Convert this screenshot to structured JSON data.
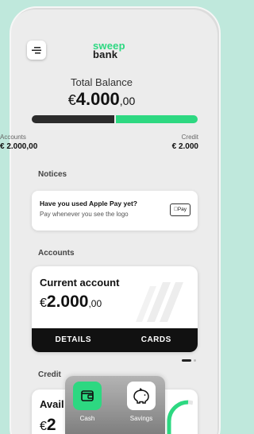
{
  "brand": {
    "line1": "sweep",
    "line2": "bank"
  },
  "balance": {
    "label": "Total Balance",
    "currency": "€",
    "main": "4.000",
    "decimals": ",00"
  },
  "balance_split": {
    "accounts_fraction": 0.5,
    "credit_fraction": 0.5
  },
  "legend": {
    "left_label": "Accounts",
    "left_value": "€ 2.000,00",
    "right_label": "Credit",
    "right_value": "€ 2.000"
  },
  "notices": {
    "title": "Notices",
    "card_title": "Have you used Apple Pay yet?",
    "card_subtitle": "Pay whenever you see the logo",
    "badge": "Pay"
  },
  "accounts": {
    "title": "Accounts",
    "card_name": "Current account",
    "currency": "€",
    "main": "2.000",
    "decimals": ",00",
    "details_label": "DETAILS",
    "cards_label": "CARDS"
  },
  "credit": {
    "title": "Credit",
    "available_label": "Avail",
    "currency": "€",
    "main": "2"
  },
  "dock": {
    "items": [
      {
        "label": "Cash",
        "icon": "wallet-icon"
      },
      {
        "label": "Savings",
        "icon": "piggy-bank-icon"
      }
    ]
  },
  "colors": {
    "accent": "#2dd881",
    "dark": "#111111",
    "background": "#bfe8dc"
  }
}
